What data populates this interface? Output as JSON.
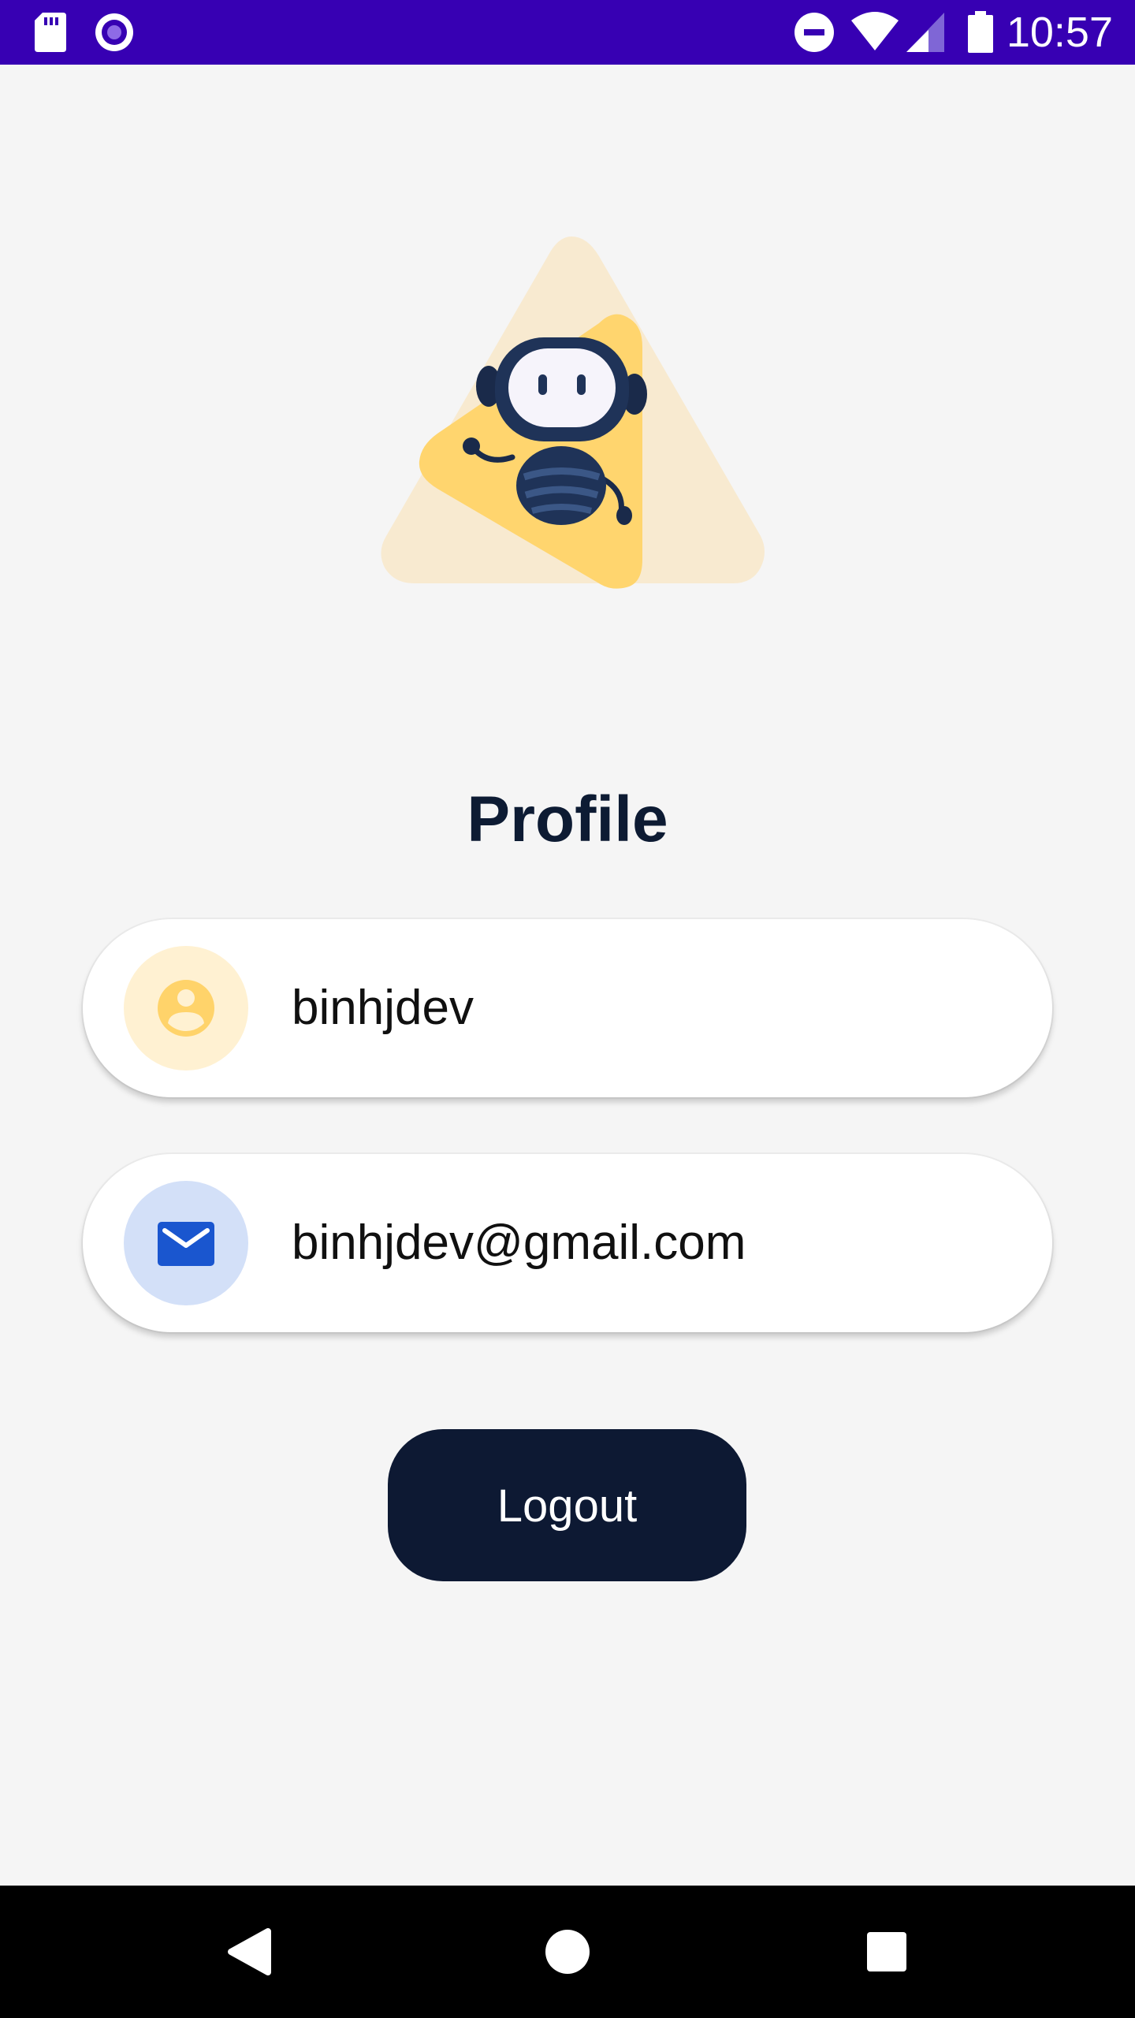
{
  "status_bar": {
    "time": "10:57",
    "icons": [
      "sd-card-icon",
      "circle-notification-icon",
      "do-not-disturb-icon",
      "wifi-icon",
      "cell-signal-icon",
      "battery-icon"
    ]
  },
  "hero": {
    "icon": "robot-icon"
  },
  "profile": {
    "title": "Profile",
    "username": "binhjdev",
    "email": "binhjdev@gmail.com"
  },
  "actions": {
    "logout_label": "Logout"
  },
  "navigation": {
    "icons": [
      "back-icon",
      "home-icon",
      "recents-icon"
    ]
  },
  "colors": {
    "status_bar": "#3700b3",
    "background": "#f5f5f5",
    "title": "#0d1b33",
    "button": "#0d1933",
    "user_accent": "#ffd36a",
    "user_accent_bg": "#fff1d2",
    "email_accent": "#1a56cf",
    "email_accent_bg": "#d3e0f8"
  }
}
